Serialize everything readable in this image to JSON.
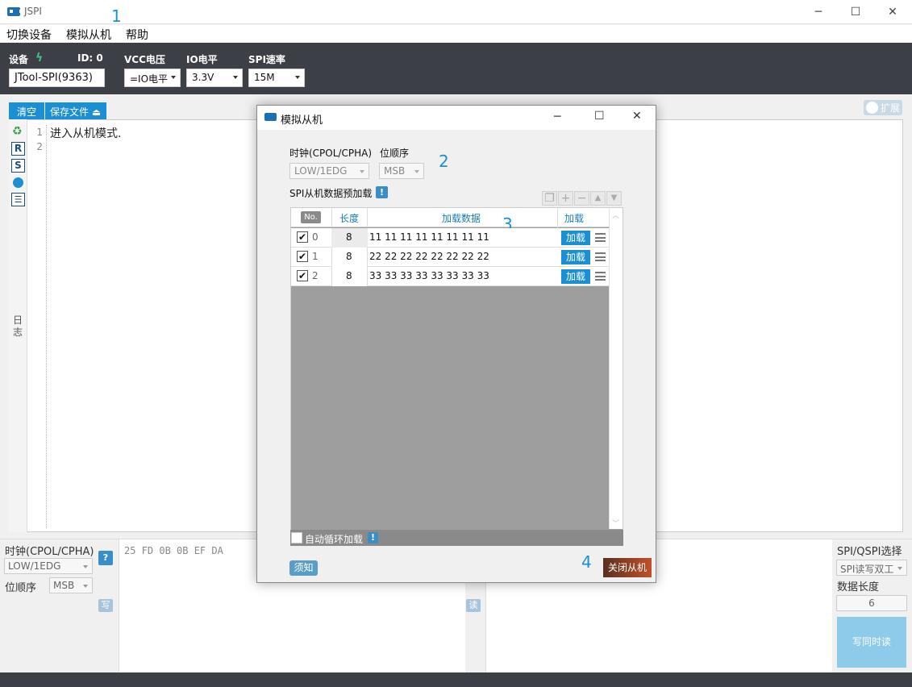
{
  "app": {
    "title": "JSPI"
  },
  "menu": [
    "切换设备",
    "模拟从机",
    "帮助"
  ],
  "device": {
    "label": "设备",
    "id_label": "ID: 0",
    "vcc_label": "VCC电压",
    "io_label": "IO电平",
    "spi_label": "SPI速率",
    "name": "JTool-SPI(9363)",
    "vcc_value": "=IO电平",
    "io_value": "3.3V",
    "spi_value": "15M"
  },
  "log": {
    "clear": "清空",
    "save": "保存文件",
    "expand": "扩展",
    "lines": [
      "1",
      "2"
    ],
    "text": "进入从机模式.",
    "side_label": "日志",
    "icon_r": "R",
    "icon_s": "S"
  },
  "bottom": {
    "clock_label": "时钟(CPOL/CPHA)",
    "clock_value": "LOW/1EDG",
    "help": "?",
    "order_label": "位顺序",
    "order_value": "MSB",
    "write": "写",
    "read": "读",
    "hex": "25 FD 0B 0B EF DA",
    "mode_label": "SPI/QSPI选择",
    "mode_value": "SPI读写双工",
    "len_label": "数据长度",
    "len_value": "6",
    "rw_button": "写同时读"
  },
  "dialog": {
    "title": "模拟从机",
    "clock_label": "时钟(CPOL/CPHA)",
    "clock_value": "LOW/1EDG",
    "order_label": "位顺序",
    "order_value": "MSB",
    "preload_label": "SPI从机数据预加载",
    "info": "!",
    "headers": {
      "no": "No.",
      "len": "长度",
      "data": "加载数据",
      "load": "加载"
    },
    "rows": [
      {
        "no": "0",
        "len": "8",
        "data": "11 11 11 11 11 11 11 11",
        "btn": "加载"
      },
      {
        "no": "1",
        "len": "8",
        "data": "22 22 22 22 22 22 22 22",
        "btn": "加载"
      },
      {
        "no": "2",
        "len": "8",
        "data": "33 33 33 33 33 33 33 33",
        "btn": "加载"
      }
    ],
    "auto_loop": "自动循环加载",
    "notice": "须知",
    "close_slave": "关闭从机"
  },
  "annotations": [
    "1",
    "2",
    "3",
    "4"
  ],
  "icons": {
    "app": "jspi-app-icon",
    "device": "lightning-icon",
    "save": "download-icon",
    "recycle": "recycle-icon",
    "clock": "clock-icon",
    "list": "list-icon",
    "copy": "copy-icon",
    "add": "plus-icon",
    "remove": "minus-icon",
    "up": "arrow-up-icon",
    "down": "arrow-down-icon",
    "menu": "menu-icon"
  },
  "colors": {
    "accent": "#1a8fd4",
    "toolbar": "#3c4046",
    "close_btn": "#b5482a"
  }
}
